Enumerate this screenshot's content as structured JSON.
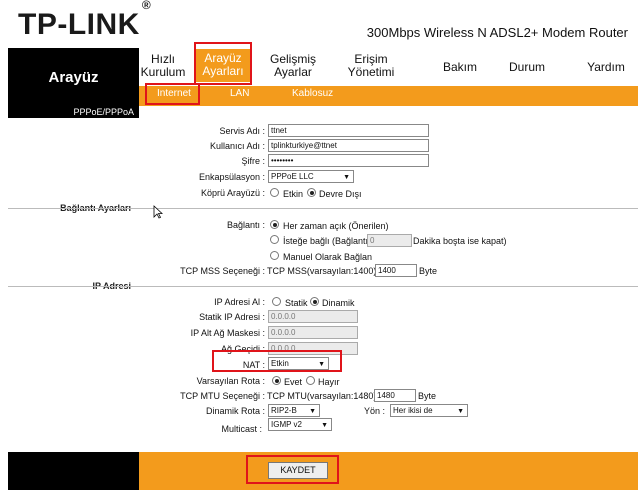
{
  "header": {
    "logo": "TP-LINK",
    "logo_mark": "®",
    "model": "300Mbps Wireless N ADSL2+ Modem Router"
  },
  "nav": {
    "current": "Arayüz",
    "items": [
      {
        "line1": "Hızlı",
        "line2": "Kurulum"
      },
      {
        "line1": "Arayüz",
        "line2": "Ayarları"
      },
      {
        "line1": "Gelişmiş",
        "line2": "Ayarlar"
      },
      {
        "line1": "Erişim",
        "line2": "Yönetimi"
      },
      {
        "line1": "Bakım",
        "line2": ""
      },
      {
        "line1": "Durum",
        "line2": ""
      },
      {
        "line1": "Yardım",
        "line2": ""
      }
    ]
  },
  "subtabs": [
    "Internet",
    "LAN",
    "Kablosuz"
  ],
  "left": {
    "header": "PPPoE/PPPoA",
    "section_connection": "Bağlantı Ayarları",
    "section_ip": "IP Adresi"
  },
  "form": {
    "service_label": "Servis Adı :",
    "service_value": "ttnet",
    "user_label": "Kullanıcı Adı :",
    "user_value": "tplinkturkiye@ttnet",
    "pass_label": "Şifre :",
    "pass_value": "••••••••",
    "encap_label": "Enkapsülasyon :",
    "encap_value": "PPPoE LLC",
    "bridge_label": "Köprü Arayüzü :",
    "bridge_opt1": "Etkin",
    "bridge_opt2": "Devre Dışı",
    "conn_label": "Bağlantı :",
    "conn_opt1": "Her zaman açık (Önerilen)",
    "conn_opt2_pre": "İsteğe bağlı (Bağlantı",
    "conn_opt2_value": "0",
    "conn_opt2_post": "Dakika boşta ise kapat)",
    "conn_opt3": "Manuel Olarak Bağlan",
    "mss_label": "TCP MSS Seçeneği :",
    "mss_text": "TCP MSS(varsayılan:1400)",
    "mss_value": "1400",
    "mss_unit": "Byte",
    "ip_label": "IP Adresi Al :",
    "ip_opt1": "Statik",
    "ip_opt2": "Dinamik",
    "static_ip_label": "Statik IP Adresi :",
    "static_ip_value": "0.0.0.0",
    "mask_label": "IP Alt Ağ Maskesi :",
    "mask_value": "0.0.0.0",
    "gateway_label": "Ağ Geçidi :",
    "gateway_value": "0.0.0.0",
    "nat_label": "NAT :",
    "nat_value": "Etkin",
    "default_route_label": "Varsayılan Rota :",
    "default_route_opt1": "Evet",
    "default_route_opt2": "Hayır",
    "mtu_label": "TCP MTU Seçeneği :",
    "mtu_text": "TCP MTU(varsayılan:1480)",
    "mtu_value": "1480",
    "mtu_unit": "Byte",
    "dyn_route_label": "Dinamik Rota :",
    "dyn_route_value": "RIP2-B",
    "direction_label": "Yön :",
    "direction_value": "Her ikisi de",
    "multicast_label": "Multicast :",
    "multicast_value": "IGMP v2"
  },
  "footer": {
    "save_label": "KAYDET"
  },
  "colors": {
    "accent": "#f39b1c",
    "highlight": "#e0141a"
  }
}
